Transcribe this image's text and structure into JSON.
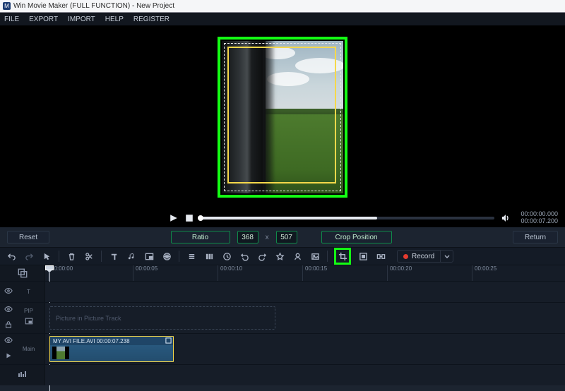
{
  "window": {
    "title": "Win Movie Maker (FULL FUNCTION) - New Project",
    "logo_letter": "M"
  },
  "menu": {
    "file": "FILE",
    "export": "EXPORT",
    "import": "IMPORT",
    "help": "HELP",
    "register": "REGISTER"
  },
  "playback": {
    "elapsed": "00:00:00.000",
    "total": "00:00:07.200"
  },
  "crop": {
    "reset": "Reset",
    "ratio": "Ratio",
    "width": "368",
    "height": "507",
    "x": "x",
    "position": "Crop Position",
    "return": "Return"
  },
  "toolbar": {
    "record": "Record"
  },
  "ruler": [
    "00:00:00",
    "00:00:05",
    "00:00:10",
    "00:00:15",
    "00:00:20",
    "00:00:25"
  ],
  "lanes": {
    "text": "T",
    "pip": "PIP",
    "pip_placeholder": "Picture in Picture Track",
    "main": "Main",
    "audio_icon": "♪"
  },
  "clip": {
    "label": "MY AVI FILE.AVI   00:00:07.238"
  }
}
